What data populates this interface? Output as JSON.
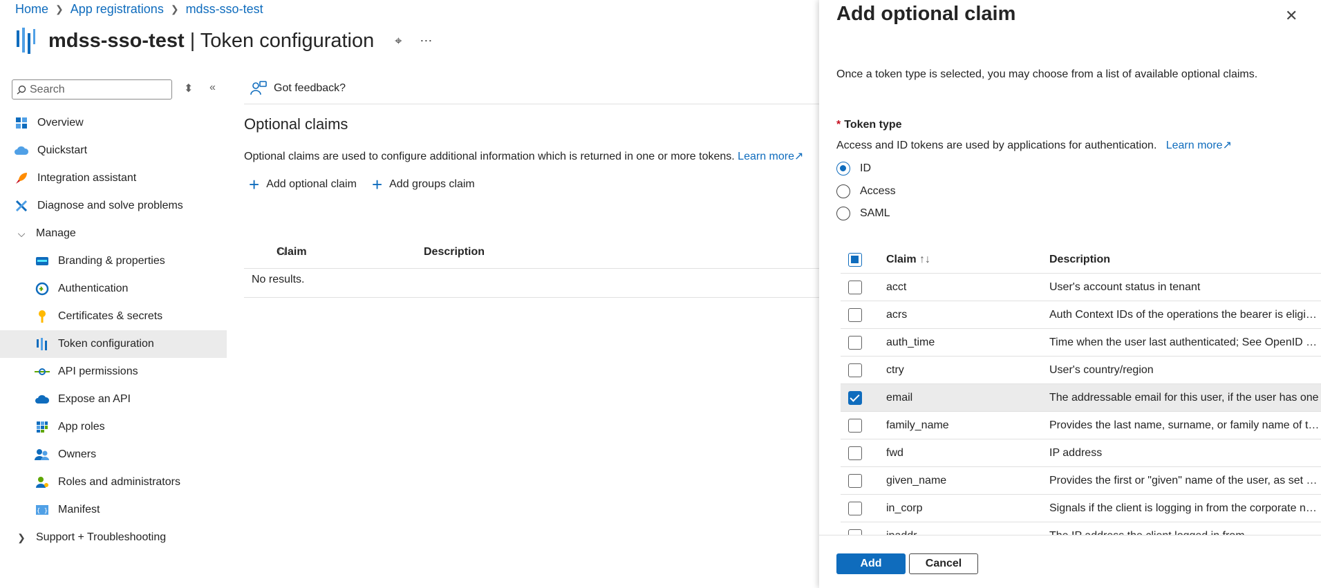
{
  "breadcrumb": [
    "Home",
    "App registrations",
    "mdss-sso-test"
  ],
  "title": {
    "app": "mdss-sso-test",
    "page": "| Token configuration"
  },
  "search": {
    "placeholder": "Search"
  },
  "nav": {
    "overview": "Overview",
    "quickstart": "Quickstart",
    "integration": "Integration assistant",
    "diagnose": "Diagnose and solve problems",
    "manage": "Manage",
    "branding": "Branding & properties",
    "authentication": "Authentication",
    "certificates": "Certificates & secrets",
    "token": "Token configuration",
    "api_permissions": "API permissions",
    "expose_api": "Expose an API",
    "app_roles": "App roles",
    "owners": "Owners",
    "roles_admins": "Roles and administrators",
    "manifest": "Manifest",
    "support": "Support + Troubleshooting"
  },
  "main": {
    "feedback": "Got feedback?",
    "section_title": "Optional claims",
    "description": "Optional claims are used to configure additional information which is returned in one or more tokens.",
    "learn_more": "Learn more",
    "add_optional_claim": "Add optional claim",
    "add_groups_claim": "Add groups claim",
    "col_claim": "Claim",
    "col_description": "Description",
    "no_results": "No results."
  },
  "panel": {
    "title": "Add optional claim",
    "intro": "Once a token type is selected, you may choose from a list of available optional claims.",
    "token_type_label": "Token type",
    "token_type_desc": "Access and ID tokens are used by applications for authentication.",
    "learn_more": "Learn more",
    "radio_id": "ID",
    "radio_access": "Access",
    "radio_saml": "SAML",
    "selected_token_type": "ID",
    "col_claim": "Claim",
    "col_description": "Description",
    "claims": [
      {
        "name": "acct",
        "desc": "User's account status in tenant",
        "checked": false
      },
      {
        "name": "acrs",
        "desc": "Auth Context IDs of the operations the bearer is eligible t...",
        "checked": false
      },
      {
        "name": "auth_time",
        "desc": "Time when the user last authenticated; See OpenID Conn...",
        "checked": false
      },
      {
        "name": "ctry",
        "desc": "User's country/region",
        "checked": false
      },
      {
        "name": "email",
        "desc": "The addressable email for this user, if the user has one",
        "checked": true
      },
      {
        "name": "family_name",
        "desc": "Provides the last name, surname, or family name of the us...",
        "checked": false
      },
      {
        "name": "fwd",
        "desc": "IP address",
        "checked": false
      },
      {
        "name": "given_name",
        "desc": "Provides the first or \"given\" name of the user, as set on th...",
        "checked": false
      },
      {
        "name": "in_corp",
        "desc": "Signals if the client is logging in from the corporate netw...",
        "checked": false
      },
      {
        "name": "ipaddr",
        "desc": "The IP address the client logged in from",
        "checked": false
      }
    ],
    "add_button": "Add",
    "cancel_button": "Cancel"
  }
}
